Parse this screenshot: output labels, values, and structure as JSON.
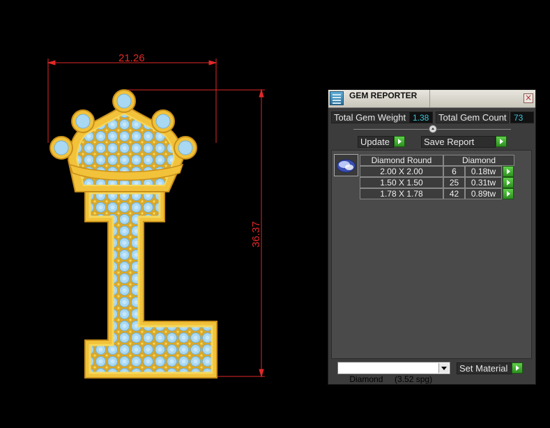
{
  "drawing": {
    "width_dimension": "21.26",
    "height_dimension": "36.37",
    "colors": {
      "dimension_line": "#e02828",
      "gold": "#f2c23a",
      "gold_dark": "#c9901a",
      "gem_blue": "#a9d8f2",
      "background": "#000000"
    }
  },
  "panel": {
    "title": "GEM REPORTER",
    "app_icon": "gem-reporter-icon",
    "close_icon": "close-icon",
    "close_glyph": "×",
    "total_weight_label": "Total Gem Weight",
    "total_weight_value": "1.38",
    "total_count_label": "Total Gem Count",
    "total_count_value": "73",
    "update_label": "Update",
    "save_report_label": "Save Report",
    "table": {
      "headers": [
        "Diamond Round",
        "Diamond"
      ],
      "rows": [
        {
          "size": "2.00 X 2.00",
          "count": "6",
          "weight": "0.18tw"
        },
        {
          "size": "1.50 X 1.50",
          "count": "25",
          "weight": "0.31tw"
        },
        {
          "size": "1.78 X 1.78",
          "count": "42",
          "weight": "0.89tw"
        }
      ]
    },
    "material_select": "Diamond     (3.52 spg)",
    "set_material_label": "Set Material",
    "accent_color": "#39c6dc",
    "play_color": "#3fae2c"
  }
}
